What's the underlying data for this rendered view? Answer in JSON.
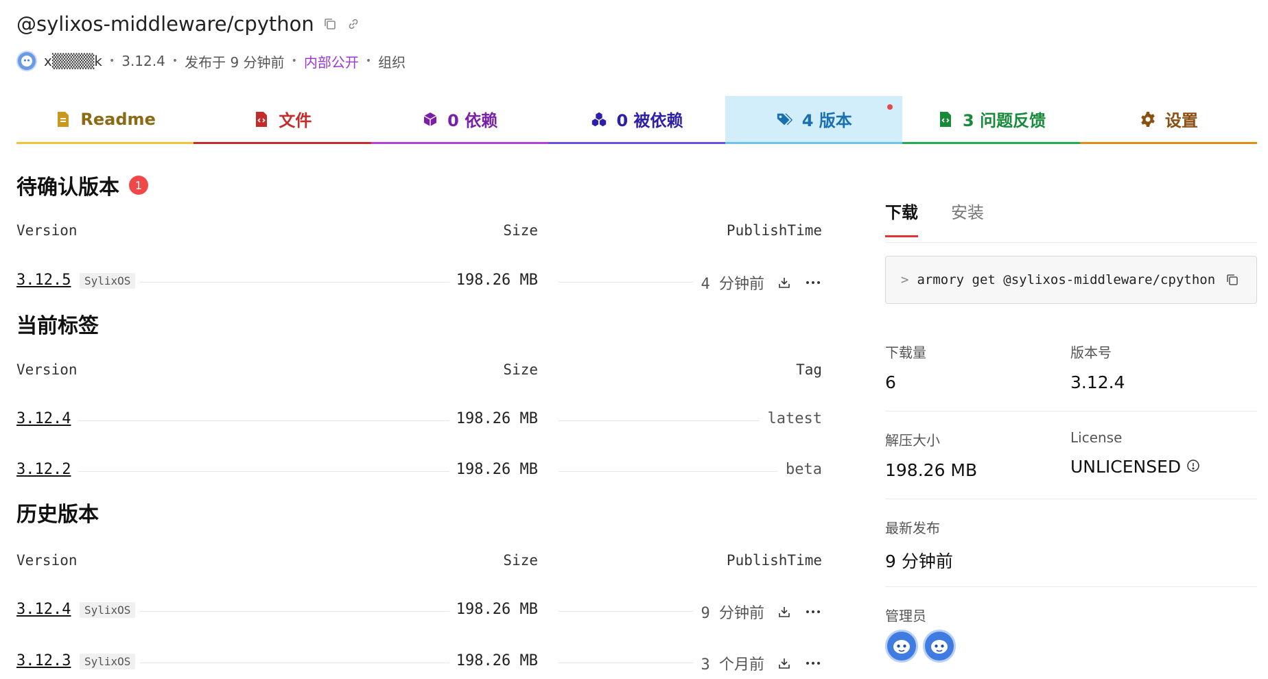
{
  "header": {
    "title": "@sylixos-middleware/cpython",
    "author": "x▒▒▒▒k",
    "version": "3.12.4",
    "published": "发布于 9 分钟前",
    "visibility": "内部公开",
    "owner_type": "组织"
  },
  "tabs": [
    {
      "label": "Readme",
      "icon": "file-text-icon"
    },
    {
      "label": "文件",
      "icon": "code-file-icon"
    },
    {
      "label": "0 依赖",
      "icon": "cube-icon"
    },
    {
      "label": "0 被依赖",
      "icon": "cubes-icon"
    },
    {
      "label": "4 版本",
      "icon": "tags-icon"
    },
    {
      "label": "3 问题反馈",
      "icon": "issue-file-icon"
    },
    {
      "label": "设置",
      "icon": "gear-icon"
    }
  ],
  "pending": {
    "title": "待确认版本",
    "count": "1",
    "headers": {
      "version": "Version",
      "size": "Size",
      "right": "PublishTime"
    },
    "rows": [
      {
        "version": "3.12.5",
        "tag": "SylixOS",
        "size": "198.26 MB",
        "time": "4 分钟前"
      }
    ]
  },
  "current": {
    "title": "当前标签",
    "headers": {
      "version": "Version",
      "size": "Size",
      "right": "Tag"
    },
    "rows": [
      {
        "version": "3.12.4",
        "size": "198.26 MB",
        "tag": "latest"
      },
      {
        "version": "3.12.2",
        "size": "198.26 MB",
        "tag": "beta"
      }
    ]
  },
  "history": {
    "title": "历史版本",
    "headers": {
      "version": "Version",
      "size": "Size",
      "right": "PublishTime"
    },
    "rows": [
      {
        "version": "3.12.4",
        "tag": "SylixOS",
        "size": "198.26 MB",
        "time": "9 分钟前"
      },
      {
        "version": "3.12.3",
        "tag": "SylixOS",
        "size": "198.26 MB",
        "time": "3 个月前"
      }
    ]
  },
  "side": {
    "tab_download": "下载",
    "tab_install": "安装",
    "prompt": ">",
    "command": "armory get @sylixos-middleware/cpython",
    "downloads_label": "下载量",
    "downloads_value": "6",
    "version_label": "版本号",
    "version_value": "3.12.4",
    "unpacked_label": "解压大小",
    "unpacked_value": "198.26 MB",
    "license_label": "License",
    "license_value": "UNLICENSED",
    "latest_label": "最新发布",
    "latest_value": "9 分钟前",
    "admins_label": "管理员"
  },
  "colors": {
    "active_tab_bg": "#d3eefb",
    "badge_red": "#f04848",
    "visibility_purple": "#9b38d6"
  }
}
